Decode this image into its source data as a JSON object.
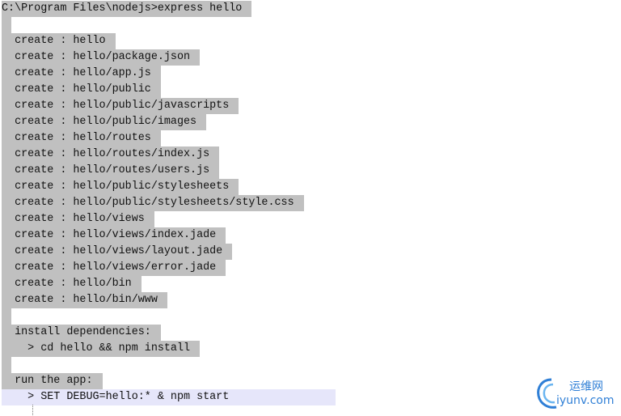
{
  "prompt_line": "C:\\Program Files\\nodejs>express hello",
  "create_lines": [
    "  create : hello",
    "  create : hello/package.json",
    "  create : hello/app.js",
    "  create : hello/public",
    "  create : hello/public/javascripts",
    "  create : hello/public/images",
    "  create : hello/routes",
    "  create : hello/routes/index.js",
    "  create : hello/routes/users.js",
    "  create : hello/public/stylesheets",
    "  create : hello/public/stylesheets/style.css",
    "  create : hello/views",
    "  create : hello/views/index.jade",
    "  create : hello/views/layout.jade",
    "  create : hello/views/error.jade",
    "  create : hello/bin",
    "  create : hello/bin/www"
  ],
  "install_header": "  install dependencies:",
  "install_cmd": "    > cd hello && npm install",
  "run_header": "  run the app:",
  "run_cmd": "    > SET DEBUG=hello:* & npm start",
  "watermark": {
    "cn": "运维网",
    "url": "iyunv.com",
    "color": "#2f7fd6"
  }
}
